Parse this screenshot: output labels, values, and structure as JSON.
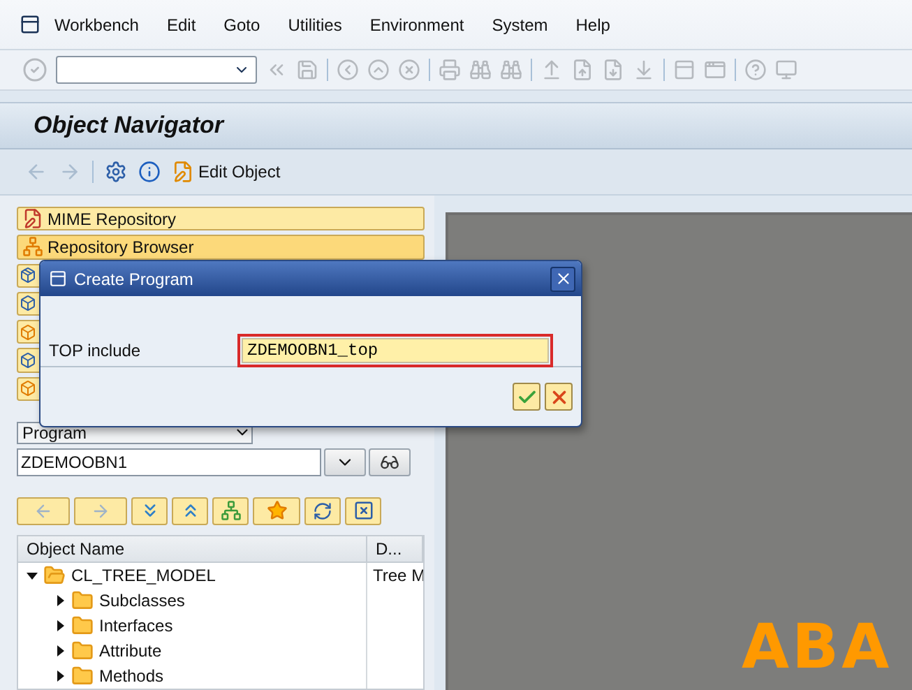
{
  "menu": [
    "Workbench",
    "Edit",
    "Goto",
    "Utilities",
    "Environment",
    "System",
    "Help"
  ],
  "title": "Object Navigator",
  "app_toolbar": {
    "edit_label": "Edit Object"
  },
  "nav_buttons": [
    {
      "label": "MIME Repository",
      "selected": false
    },
    {
      "label": "Repository Browser",
      "selected": true
    }
  ],
  "object_type": "Program",
  "object_name": "ZDEMOOBN1",
  "tree": {
    "columns": [
      "Object Name",
      "D..."
    ],
    "rows": [
      {
        "name": "CL_TREE_MODEL",
        "description": "Tree M",
        "expanded": true,
        "children": [
          {
            "name": "Subclasses",
            "expanded": false
          },
          {
            "name": "Interfaces",
            "expanded": false
          },
          {
            "name": "Attribute",
            "expanded": false
          },
          {
            "name": "Methods",
            "expanded": false
          }
        ]
      }
    ]
  },
  "canvas": {
    "text": "ABA"
  },
  "dialog": {
    "title": "Create Program",
    "field_label": "TOP include",
    "field_value": "ZDEMOOBN1_top"
  }
}
